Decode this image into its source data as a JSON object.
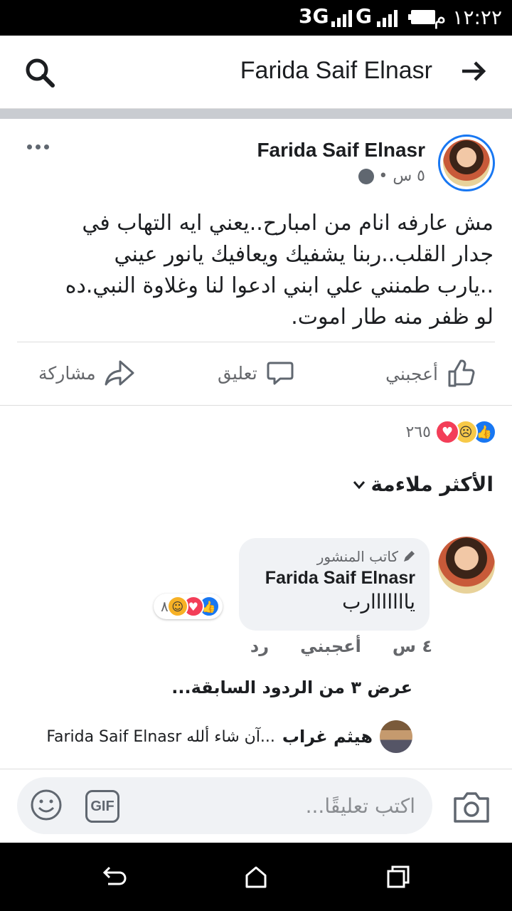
{
  "status_bar": {
    "time": "١٢:٢٢ م",
    "network_1": "3G",
    "network_2": "G"
  },
  "header": {
    "title": "Farida Saif Elnasr"
  },
  "post": {
    "author": "Farida Saif Elnasr",
    "time": "٥ س •",
    "text": "مش عارفه انام من امبارح..يعني ايه التهاب في\nجدار القلب..ربنا يشفيك ويعافيك يانور عيني\n..يارب طمنني علي ابني ادعوا لنا وغلاوة النبي.ده\nلو ظفر منه طار اموت.",
    "actions": {
      "like": "أعجبني",
      "comment": "تعليق",
      "share": "مشاركة"
    },
    "reaction_count": "٢٦٥"
  },
  "sort_label": "الأكثر ملاءمة",
  "comment": {
    "badge": "كاتب المنشور",
    "author": "Farida Saif Elnasr",
    "text": "يااااااارب",
    "reaction_count": "٨",
    "time": "٤ س",
    "like": "أعجبني",
    "reply": "رد"
  },
  "view_replies": "عرض ٣ من الردود السابقة...",
  "latest_reply": {
    "name": "هيثم غراب",
    "text": "...آن شاء ألله Farida Saif Elnasr"
  },
  "composer": {
    "placeholder": "اكتب تعليقًا...",
    "gif_label": "GIF"
  }
}
